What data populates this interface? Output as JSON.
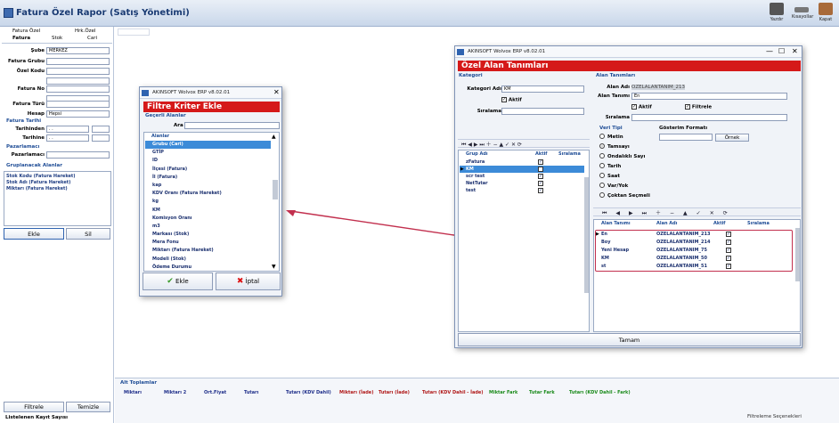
{
  "app": {
    "title": "Fatura Özel Rapor (Satış Yönetimi)"
  },
  "toolbar": {
    "print": "Yazdır",
    "templates": "Kısayollar",
    "close": "Kapat"
  },
  "left": {
    "top_tabs": [
      "Fatura Özel",
      "Hrk.Özel"
    ],
    "sub_tabs": [
      "Fatura",
      "Stok",
      "Cari"
    ],
    "fields": [
      {
        "label": "Şube",
        "value": "MERKEZ"
      },
      {
        "label": "Fatura Grubu",
        "value": ""
      },
      {
        "label": "Özel Kodu",
        "value": ""
      },
      {
        "label": "Fatura No",
        "value": ""
      },
      {
        "label": "Fatura Türü",
        "value": ""
      },
      {
        "label": "Hesap",
        "value": "Hepsi"
      }
    ],
    "date_section": "Fatura Tarihi",
    "date_from_label": "Tarihinden",
    "date_to_label": "Tarihine",
    "date_value": ". .",
    "sales_section": "Pazarlamacı",
    "sales_label": "Pazarlamacı",
    "group_section": "Gruplanacak Alanlar",
    "group_items": [
      "Stok Kodu (Fatura Hareket)",
      "Stok Adı (Fatura Hareket)",
      "Miktarı (Fatura Hareket)"
    ],
    "add_btn": "Ekle",
    "del_btn": "Sil",
    "filter_btn": "Filtrele",
    "clear_btn": "Temizle",
    "status": "Listelenen Kayıt Sayısı"
  },
  "bottom": {
    "section": "Alt Toplamlar",
    "columns": [
      {
        "label": "Miktarı",
        "color": "#1f2f8a"
      },
      {
        "label": "Miktarı 2",
        "color": "#1f2f8a"
      },
      {
        "label": "Ort.Fiyat",
        "color": "#1f2f8a"
      },
      {
        "label": "Tutarı",
        "color": "#1f2f8a"
      },
      {
        "label": "Tutarı (KDV Dahil)",
        "color": "#1f2f8a"
      },
      {
        "label": "Miktarı (İade)",
        "color": "#b01818"
      },
      {
        "label": "Tutarı (İade)",
        "color": "#b01818"
      },
      {
        "label": "Tutarı (KDV Dahil - İade)",
        "color": "#b01818"
      },
      {
        "label": "Miktar Fark",
        "color": "#1a8a1a"
      },
      {
        "label": "Tutar Fark",
        "color": "#1a8a1a"
      },
      {
        "label": "Tutarı (KDV Dahil - Fark)",
        "color": "#1a8a1a"
      }
    ],
    "filter_label": "Filtreleme Seçenekleri"
  },
  "dlg1": {
    "window_title": "AKINSOFT Wolvox ERP v8.02.01",
    "title": "Filtre Kriter Ekle",
    "section": "Geçerli Alanlar",
    "search_label": "Ara",
    "list_header": "Alanlar",
    "items": [
      "Grubu (Cari)",
      "GTİP",
      "ID",
      "İlçesi (Fatura)",
      "İl (Fatura)",
      "kap",
      "KDV Oranı (Fatura Hareket)",
      "kg",
      "KM",
      "Komisyon Oranı",
      "m3",
      "Markası (Stok)",
      "Mera Fonu",
      "Miktarı (Fatura Hareket)",
      "Modeli (Stok)",
      "Ödeme Durumu"
    ],
    "add_btn": "Ekle",
    "cancel_btn": "İptal"
  },
  "dlg2": {
    "window_title": "AKINSOFT Wolvox ERP v8.02.01",
    "title": "Özel Alan Tanımları",
    "cat_section": "Kategori",
    "cat_name_label": "Kategori Adı",
    "cat_name_value": "KM",
    "active_label": "Aktif",
    "order_label": "Sıralama",
    "cat_cols": [
      "Grup Adı",
      "Aktif",
      "Sıralama"
    ],
    "cat_rows": [
      "zFatura",
      "KM",
      "scr test",
      "NetTutar",
      "test"
    ],
    "field_section": "Alan Tanımları",
    "field_name_label": "Alan Adı",
    "field_name_value": "OZELALANTANIM_213",
    "field_def_label": "Alan Tanımı",
    "field_def_value": "En",
    "filter_label": "Filtrele",
    "value_type_label": "Veri Tipi",
    "display_format_label": "Gösterim Formatı",
    "example_btn": "Örnek",
    "types": [
      "Metin",
      "Tamsayı",
      "Ondalıklı Sayı",
      "Tarih",
      "Saat",
      "Var/Yok",
      "Çoktan Seçmeli"
    ],
    "field_cols": [
      "Alan Tanımı",
      "Alan Adı",
      "Aktif",
      "Sıralama"
    ],
    "field_rows": [
      {
        "def": "En",
        "name": "OZELALANTANIM_213"
      },
      {
        "def": "Boy",
        "name": "OZELALANTANIM_214"
      },
      {
        "def": "Yeni Hesap",
        "name": "OZELALANTANIM_75"
      },
      {
        "def": "KM",
        "name": "OZELALANTANIM_50"
      },
      {
        "def": "st",
        "name": "OZELALANTANIM_51"
      }
    ],
    "done_btn": "Tamam"
  }
}
